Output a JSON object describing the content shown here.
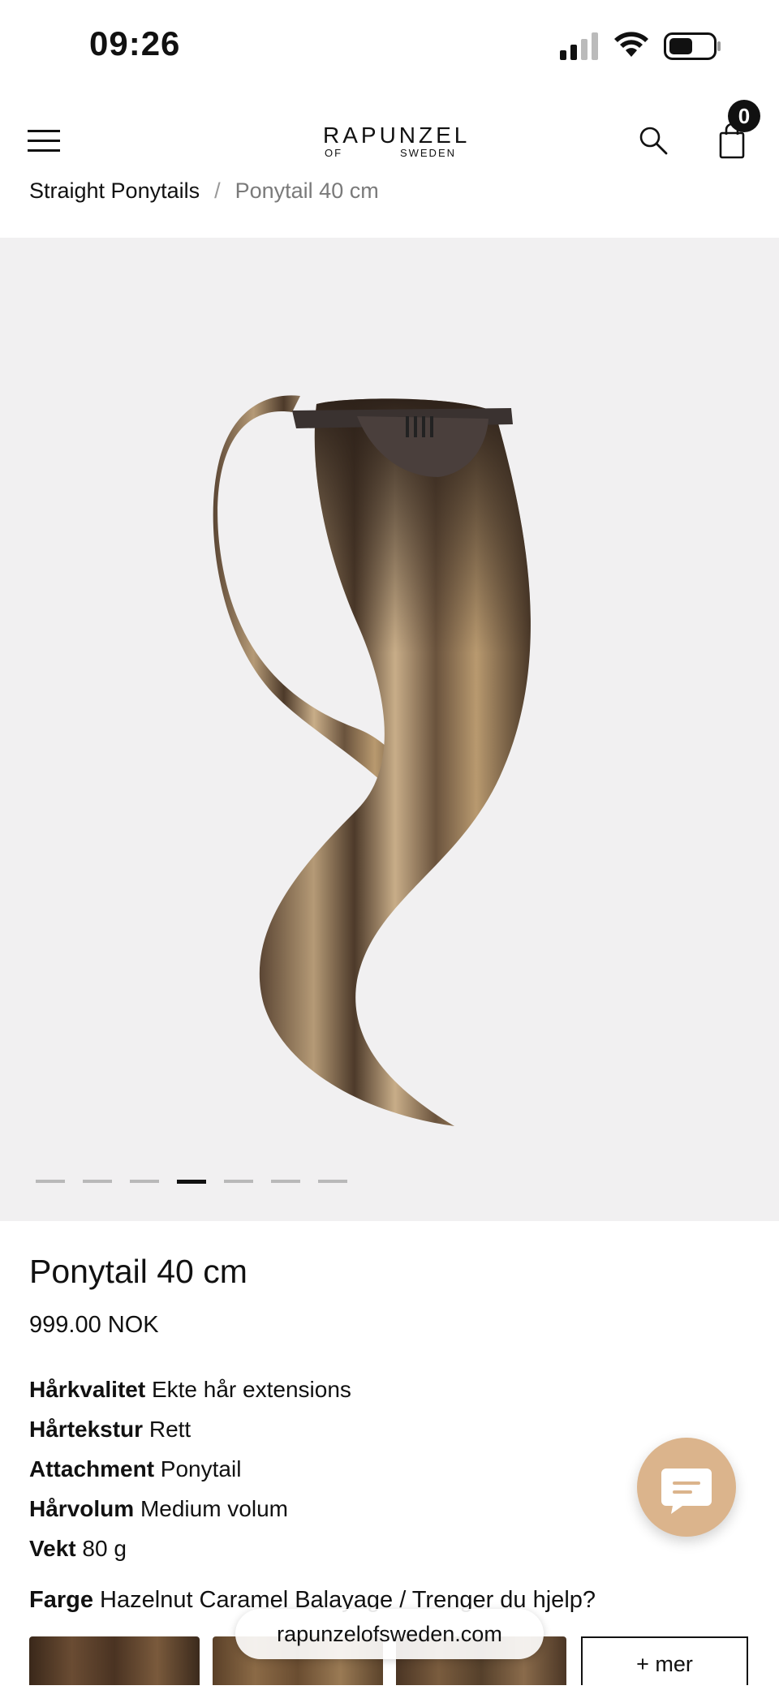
{
  "status_bar": {
    "time": "09:26"
  },
  "header": {
    "logo_line1": "RAPUNZEL",
    "logo_of": "OF",
    "logo_sweden": "SWEDEN",
    "cart_count": "0"
  },
  "breadcrumb": {
    "parent": "Straight Ponytails",
    "separator": "/",
    "current": "Ponytail 40 cm"
  },
  "gallery": {
    "image_count": 7,
    "active_index": 3
  },
  "product": {
    "title": "Ponytail 40 cm",
    "price": "999.00 NOK",
    "attributes": [
      {
        "label": "Hårkvalitet",
        "value": "Ekte hår extensions"
      },
      {
        "label": "Hårtekstur",
        "value": "Rett"
      },
      {
        "label": "Attachment",
        "value": "Ponytail"
      },
      {
        "label": "Hårvolum",
        "value": "Medium volum"
      },
      {
        "label": "Vekt",
        "value": "80 g"
      }
    ],
    "color_label": "Farge",
    "color_value": "Hazelnut Caramel Balayage / Trenger du hjelp?",
    "more_colors": "+ mer"
  },
  "browser": {
    "url": "rapunzelofsweden.com"
  },
  "icons": {
    "menu": "hamburger-icon",
    "search": "search-icon",
    "cart": "shopping-bag-icon",
    "chat": "chat-bubble-icon"
  },
  "colors": {
    "gallery_bg": "#f1f0f1",
    "chat_accent": "#dbb48c"
  }
}
